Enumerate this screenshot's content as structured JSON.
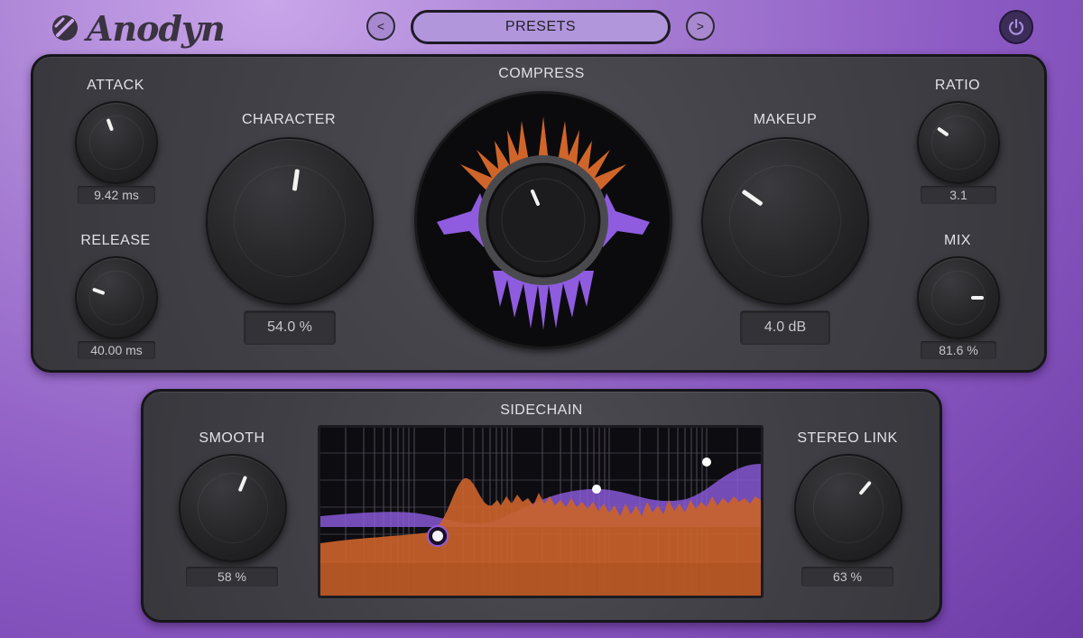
{
  "header": {
    "brand": "Anodyn",
    "prev_label": "<",
    "next_label": ">",
    "presets_label": "PRESETS"
  },
  "controls": {
    "attack": {
      "label": "ATTACK",
      "value": "9.42 ms"
    },
    "release": {
      "label": "RELEASE",
      "value": "40.00 ms"
    },
    "character": {
      "label": "CHARACTER",
      "value": "54.0 %"
    },
    "compress": {
      "label": "COMPRESS"
    },
    "makeup": {
      "label": "MAKEUP",
      "value": "4.0 dB"
    },
    "ratio": {
      "label": "RATIO",
      "value": "3.1"
    },
    "mix": {
      "label": "MIX",
      "value": "81.6 %"
    }
  },
  "sidechain": {
    "label": "SIDECHAIN",
    "smooth": {
      "label": "SMOOTH",
      "value": "58 %"
    },
    "stereo_link": {
      "label": "STEREO LINK",
      "value": "63 %"
    }
  },
  "colors": {
    "accent_orange": "#d0652a",
    "accent_purple": "#8f5ce0"
  },
  "icons": [
    "logo-icon",
    "chevron-left-icon",
    "chevron-right-icon",
    "power-icon"
  ]
}
